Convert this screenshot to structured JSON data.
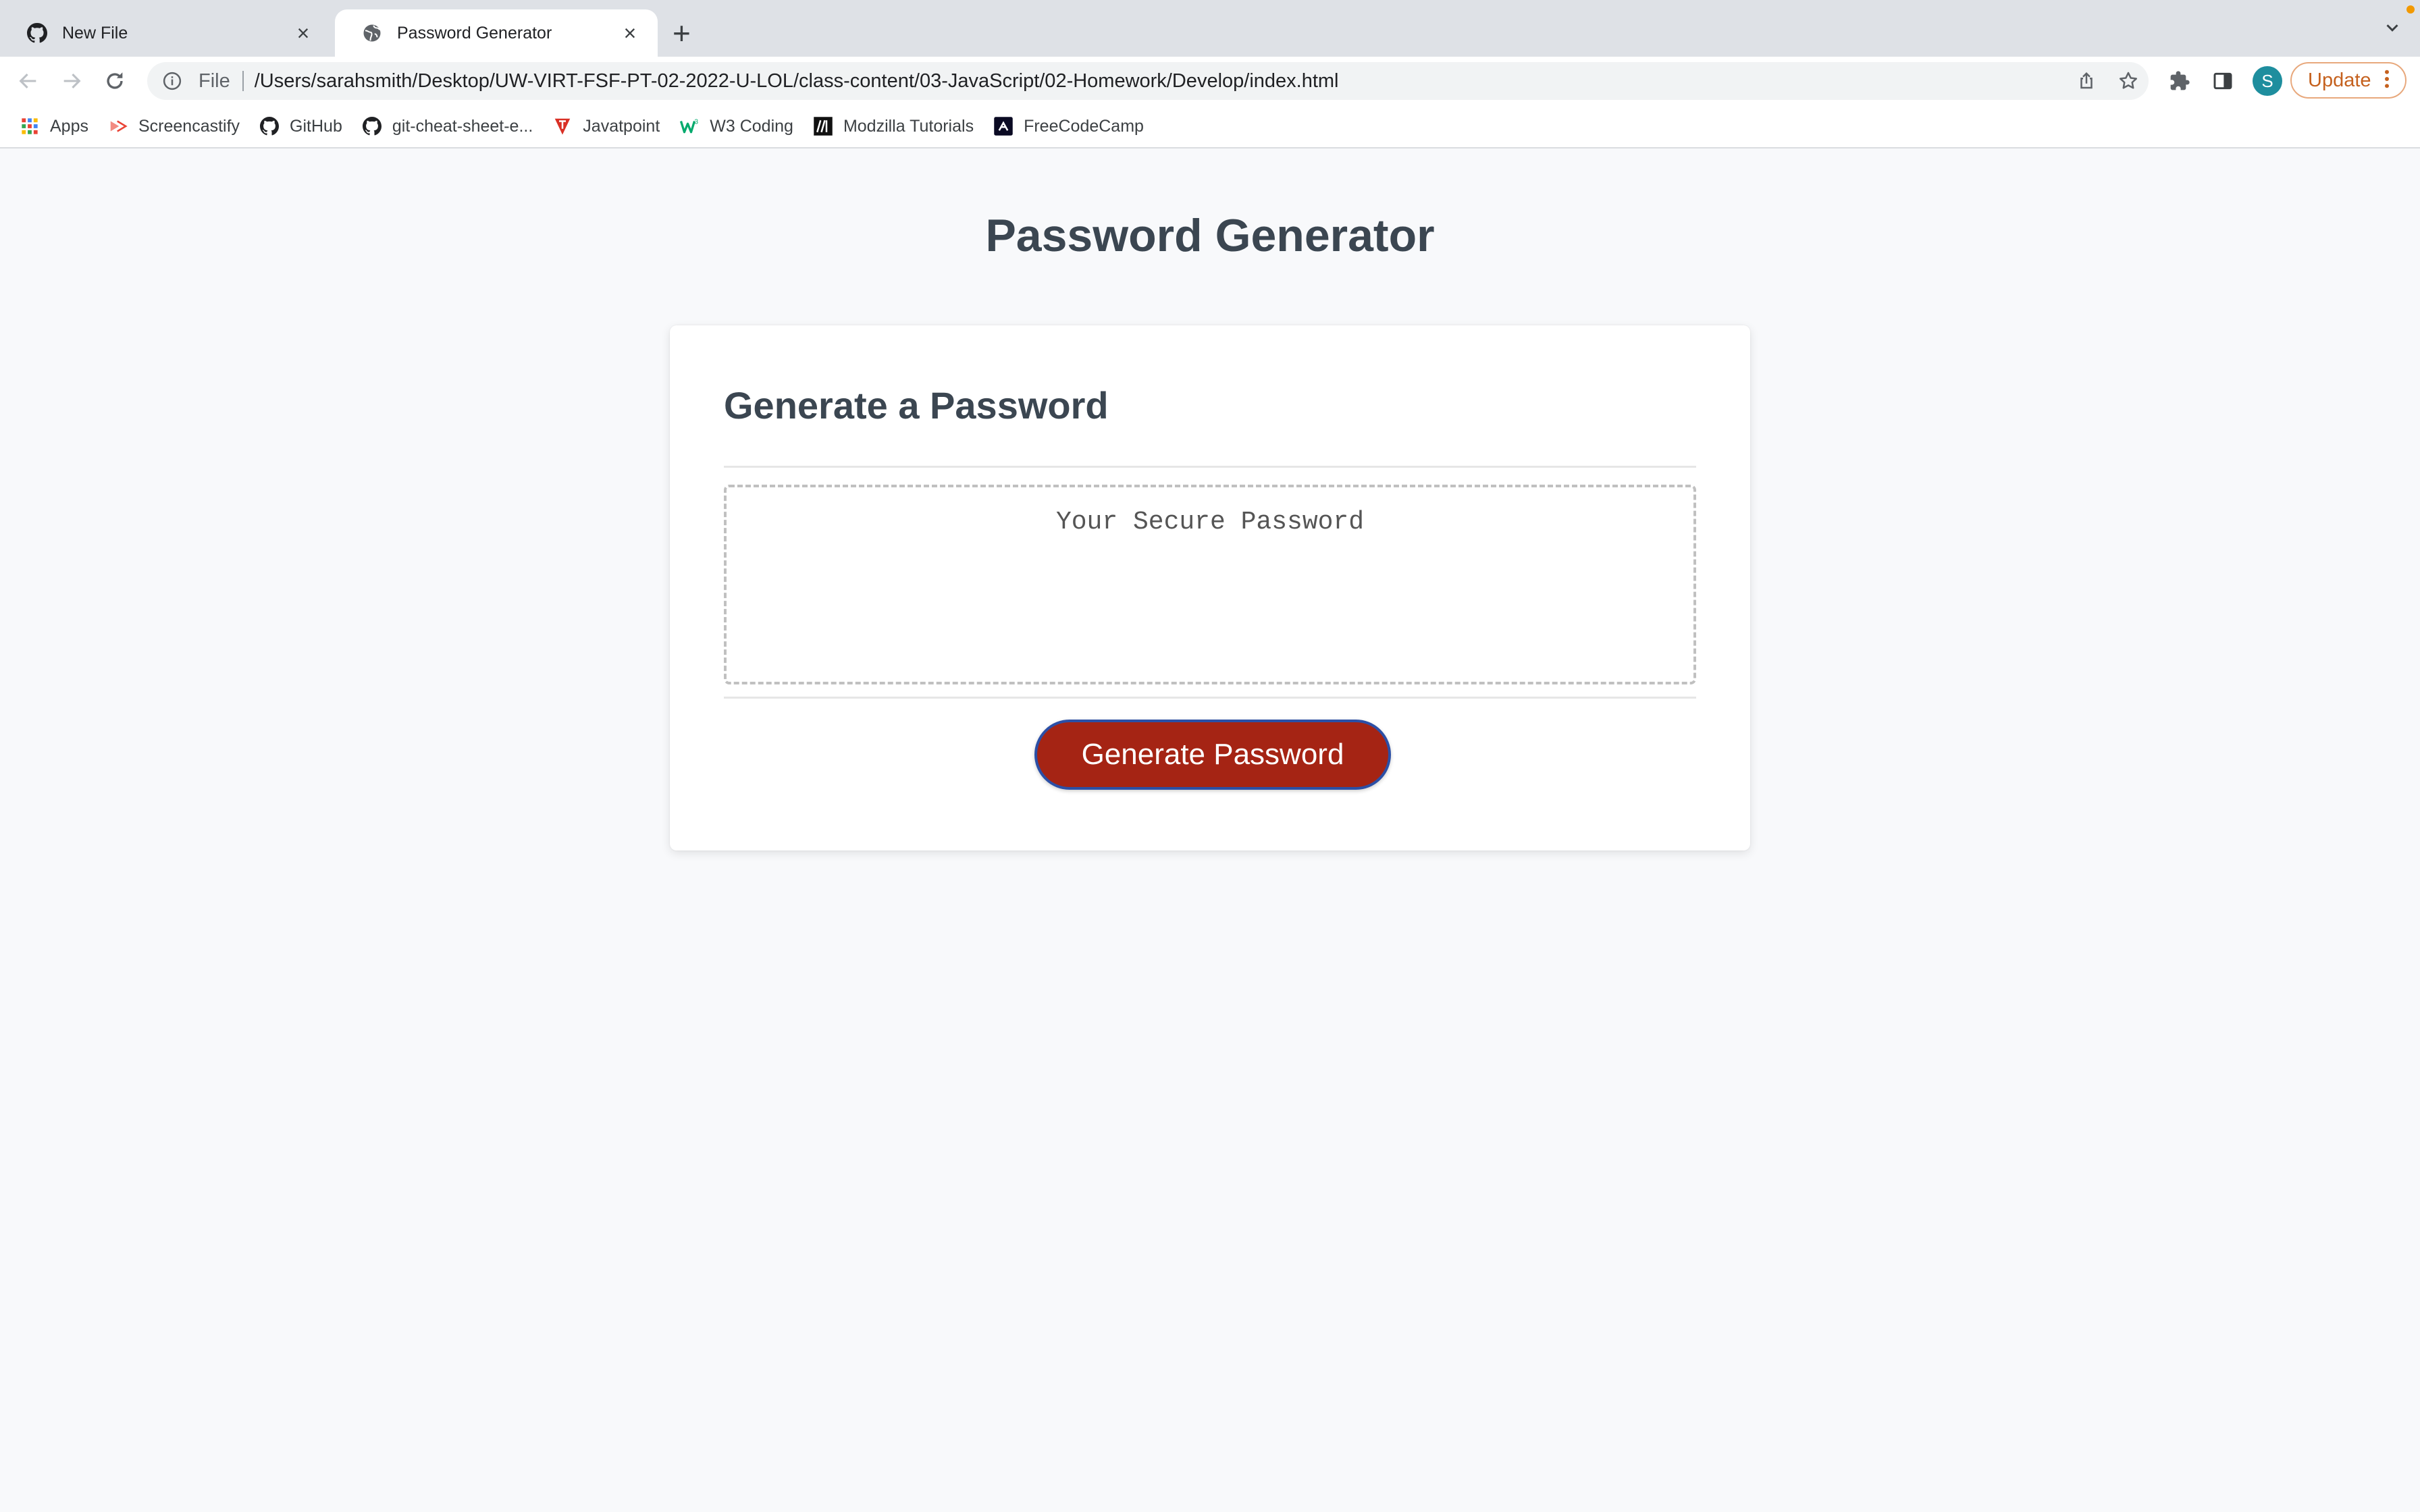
{
  "browser": {
    "tabs": [
      {
        "title": "New File",
        "icon": "github-icon"
      },
      {
        "title": "Password Generator",
        "icon": "globe-icon"
      }
    ],
    "omnibox": {
      "scheme": "File",
      "url": "/Users/sarahsmith/Desktop/UW-VIRT-FSF-PT-02-2022-U-LOL/class-content/03-JavaScript/02-Homework/Develop/index.html"
    },
    "profile_initial": "S",
    "update_label": "Update",
    "bookmarks": [
      {
        "label": "Apps",
        "icon": "apps-grid-icon"
      },
      {
        "label": "Screencastify",
        "icon": "screencastify-icon"
      },
      {
        "label": "GitHub",
        "icon": "github-icon"
      },
      {
        "label": "git-cheat-sheet-e...",
        "icon": "github-icon"
      },
      {
        "label": "Javatpoint",
        "icon": "javatpoint-icon"
      },
      {
        "label": "W3 Coding",
        "icon": "w3-icon"
      },
      {
        "label": "Modzilla Tutorials",
        "icon": "mdn-icon"
      },
      {
        "label": "FreeCodeCamp",
        "icon": "freecodecamp-icon"
      }
    ]
  },
  "page": {
    "title": "Password Generator",
    "card": {
      "header": "Generate a Password",
      "password_placeholder": "Your Secure Password",
      "generate_button": "Generate Password"
    }
  },
  "colors": {
    "button_bg": "#a52414",
    "button_border": "#2b4fa6",
    "heading": "#3b4651",
    "page_bg": "#f8f9fb"
  }
}
